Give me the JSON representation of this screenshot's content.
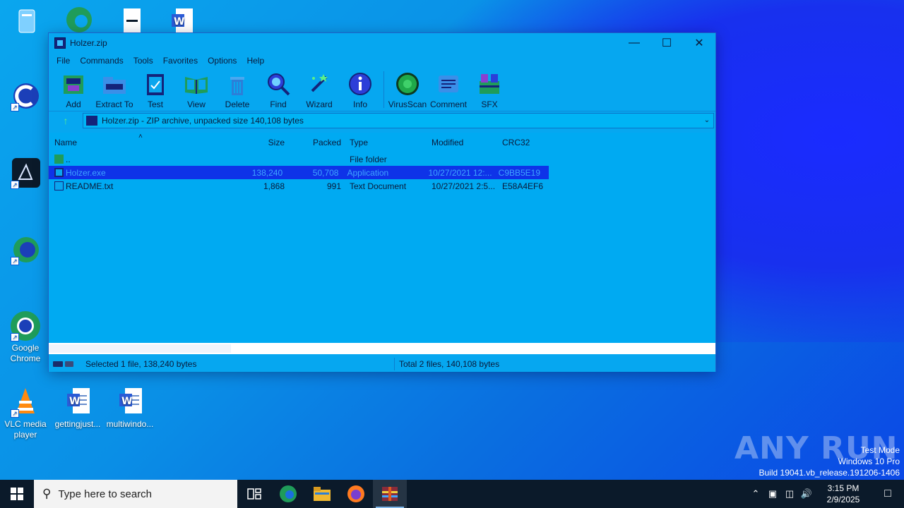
{
  "desktop": {
    "icons": [
      {
        "label": "Google Chrome"
      },
      {
        "label": "VLC media player"
      },
      {
        "label": "gettingjust..."
      },
      {
        "label": "multiwindo..."
      }
    ]
  },
  "window": {
    "title": "Holzer.zip",
    "menu": [
      "File",
      "Commands",
      "Tools",
      "Favorites",
      "Options",
      "Help"
    ],
    "toolbar": [
      "Add",
      "Extract To",
      "Test",
      "View",
      "Delete",
      "Find",
      "Wizard",
      "Info",
      "VirusScan",
      "Comment",
      "SFX"
    ],
    "address": "Holzer.zip - ZIP archive, unpacked size 140,108 bytes",
    "columns": {
      "name": "Name",
      "size": "Size",
      "packed": "Packed",
      "type": "Type",
      "modified": "Modified",
      "crc": "CRC32"
    },
    "rows": [
      {
        "name": "..",
        "size": "",
        "packed": "",
        "type": "File folder",
        "modified": "",
        "crc": ""
      },
      {
        "name": "Holzer.exe",
        "size": "138,240",
        "packed": "50,708",
        "type": "Application",
        "modified": "10/27/2021 12:...",
        "crc": "C9BB5E19"
      },
      {
        "name": "README.txt",
        "size": "1,868",
        "packed": "991",
        "type": "Text Document",
        "modified": "10/27/2021 2:5...",
        "crc": "E58A4EF6"
      }
    ],
    "status_left": "Selected 1 file, 138,240 bytes",
    "status_right": "Total 2 files, 140,108 bytes"
  },
  "watermark": {
    "brand": "ANY RUN",
    "line1": "Test Mode",
    "line2": "Windows 10 Pro",
    "line3": "Build 19041.vb_release.191206-1406"
  },
  "taskbar": {
    "search_placeholder": "Type here to search",
    "time": "3:15 PM",
    "date": "2/9/2025"
  }
}
